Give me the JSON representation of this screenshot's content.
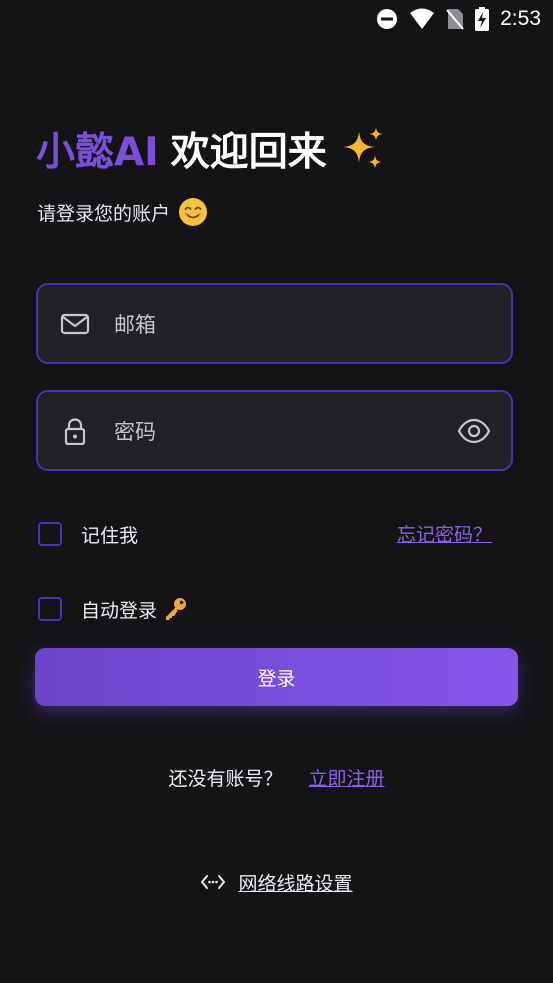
{
  "status_bar": {
    "time": "2:53",
    "icons": [
      "do-not-disturb-icon",
      "wifi-icon",
      "no-sim-icon",
      "battery-charging-icon"
    ]
  },
  "header": {
    "brand": "小懿AI",
    "welcome": "欢迎回来",
    "title_icon": "sparkles-icon",
    "subtitle": "请登录您的账户",
    "subtitle_icon": "smiling-face-icon"
  },
  "form": {
    "email": {
      "icon": "mail-icon",
      "placeholder": "邮箱",
      "value": ""
    },
    "password": {
      "icon": "lock-icon",
      "placeholder": "密码",
      "value": "",
      "toggle_icon": "eye-icon"
    },
    "remember_me": {
      "label": "记住我",
      "checked": false
    },
    "forgot_password": "忘记密码？",
    "auto_login": {
      "label": "自动登录",
      "icon": "key-icon",
      "checked": false
    },
    "login_button": "登录"
  },
  "footer": {
    "register_prompt": "还没有账号？",
    "register_link": "立即注册",
    "network_icon": "code-icon",
    "network_settings": "网络线路设置"
  },
  "colors": {
    "background": "#141316",
    "accent": "#7b4fdc",
    "input_border": "#4a32b6",
    "input_background": "#222126",
    "button_gradient_start": "#6a44c8",
    "button_gradient_end": "#8556ea",
    "link": "#8b63e6"
  }
}
